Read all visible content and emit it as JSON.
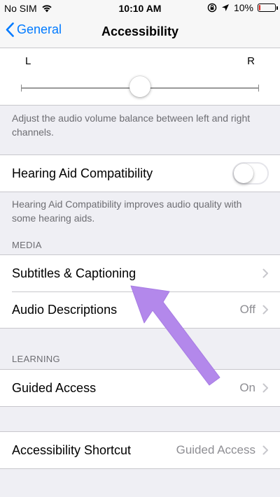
{
  "status_bar": {
    "carrier": "No SIM",
    "time": "10:10 AM",
    "battery_percent": "10%",
    "battery_level": 0.1,
    "battery_color": "#e2231a"
  },
  "nav": {
    "back_label": "General",
    "title": "Accessibility"
  },
  "balance": {
    "left_label": "L",
    "right_label": "R",
    "value": 0.5,
    "footer": "Adjust the audio volume balance between left and right channels."
  },
  "hearing_aid": {
    "label": "Hearing Aid Compatibility",
    "enabled": false,
    "footer": "Hearing Aid Compatibility improves audio quality with some hearing aids."
  },
  "media": {
    "header": "MEDIA",
    "items": [
      {
        "label": "Subtitles & Captioning",
        "value": ""
      },
      {
        "label": "Audio Descriptions",
        "value": "Off"
      }
    ]
  },
  "learning": {
    "header": "LEARNING",
    "items": [
      {
        "label": "Guided Access",
        "value": "On"
      }
    ]
  },
  "shortcut": {
    "label": "Accessibility Shortcut",
    "value": "Guided Access"
  },
  "colors": {
    "accent": "#007aff",
    "annotation_arrow": "#b388eb"
  }
}
